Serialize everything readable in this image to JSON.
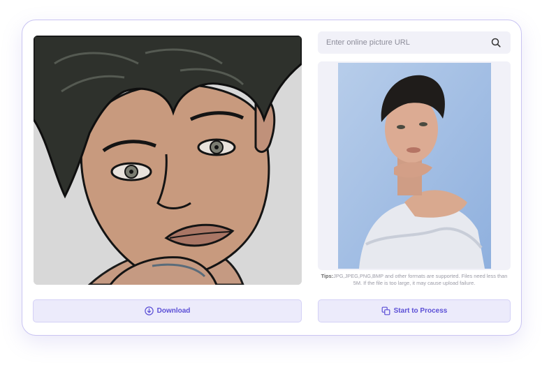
{
  "search": {
    "placeholder": "Enter online picture URL",
    "icon": "search-icon"
  },
  "tips": {
    "label": "Tips:",
    "text": "JPG,JPEG,PNG,BMP and other formats are supported. Files need less than 5M. If the file is too large, it may cause upload failure."
  },
  "buttons": {
    "download_label": "Download",
    "download_icon": "download-icon",
    "process_label": "Start to Process",
    "process_icon": "copy-icon"
  },
  "colors": {
    "accent": "#5b4fd6",
    "button_bg": "#ecebfb",
    "card_border": "#c9c4f2",
    "panel_bg": "#f1f1f8"
  }
}
